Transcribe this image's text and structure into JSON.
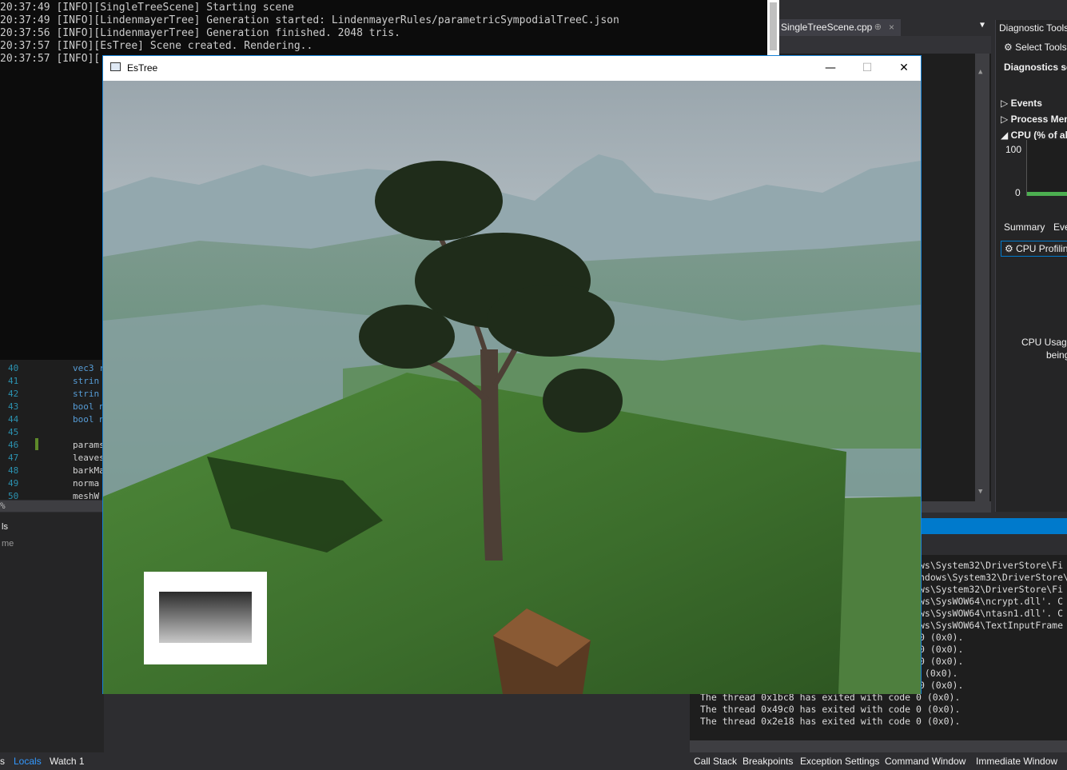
{
  "console": {
    "lines": [
      "20:37:49 [INFO][SingleTreeScene] Starting scene",
      "20:37:49 [INFO][LindenmayerTree] Generation started: LindenmayerRules/parametricSympodialTreeC.json",
      "20:37:56 [INFO][LindenmayerTree] Generation finished. 2048 tris.",
      "20:37:57 [INFO][EsTree] Scene created. Rendering..",
      "20:37:57 [INFO][",
      "Generation finished"
    ]
  },
  "editor": {
    "tab_label": "SingleTreeScene.cpp",
    "tab_pin": "⊕",
    "tab_close": "×",
    "line_numbers": [
      "40",
      "41",
      "42",
      "43",
      "44",
      "45",
      "46",
      "47",
      "48",
      "49",
      "50"
    ],
    "code_lines": [
      "vec3 r",
      "strin",
      "strin",
      "bool n",
      "bool n",
      "",
      "params",
      "leaves",
      "barkMa",
      "norma",
      "meshW"
    ],
    "zoom": "%"
  },
  "diagnostics": {
    "title": "Diagnostic Tools",
    "select_tools": "Select Tools",
    "session": "Diagnostics se",
    "events": "Events",
    "process_memory": "Process Mem",
    "cpu": "CPU (% of all",
    "cpu_max": "100",
    "cpu_min": "0",
    "tab_summary": "Summary",
    "tab_events": "Eve",
    "cpu_profiling": "CPU Profilin",
    "cpu_usage": "CPU Usage",
    "being": "being"
  },
  "left_panel": {
    "title": "ls",
    "column": "me"
  },
  "output": {
    "lines": [
      "ws\\System32\\DriverStore\\Fi",
      "ndows\\System32\\DriverStore\\",
      "ws\\System32\\DriverStore\\Fi",
      "ws\\SysWOW64\\ncrypt.dll'. C",
      "ws\\SysWOW64\\ntasn1.dll'. C",
      "ws\\SysWOW64\\TextInputFrame",
      "0 (0x0).",
      "0 (0x0).",
      "0 (0x0).",
      " (0x0).",
      "0 (0x0).",
      "The thread 0x1bc8 has exited with code 0 (0x0).",
      "The thread 0x49c0 has exited with code 0 (0x0).",
      "The thread 0x2e18 has exited with code 0 (0x0)."
    ]
  },
  "bottom_tabs": {
    "left": [
      "s",
      "Locals",
      "Watch 1"
    ],
    "right": [
      "Call Stack",
      "Breakpoints",
      "Exception Settings",
      "Command Window",
      "Immediate Window"
    ]
  },
  "game_window": {
    "title": "EsTree",
    "minimize": "—",
    "maximize": "☐",
    "close": "✕"
  }
}
